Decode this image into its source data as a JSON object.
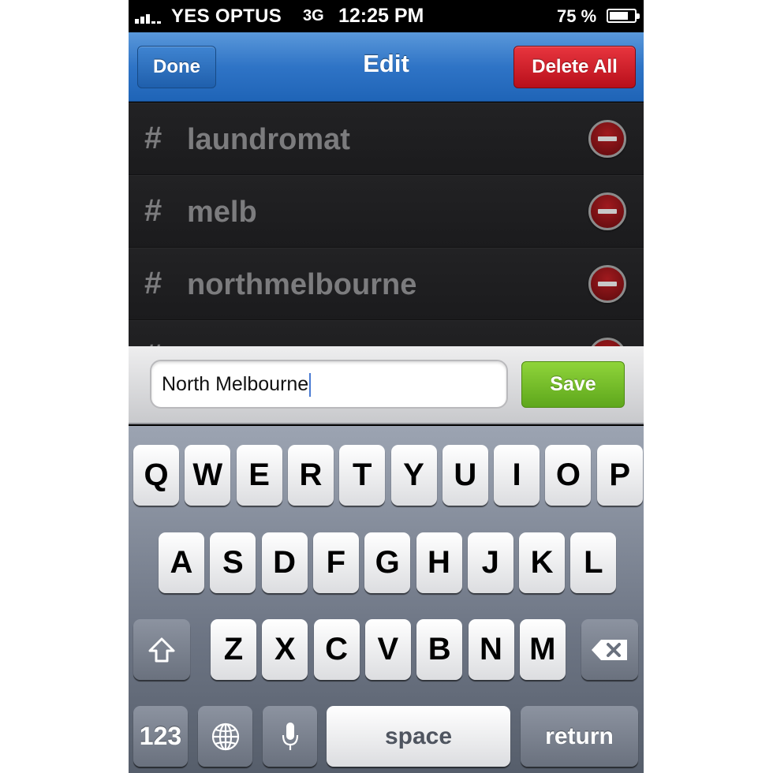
{
  "status_bar": {
    "carrier": "YES OPTUS",
    "network": "3G",
    "time": "12:25 PM",
    "battery_percent": "75 %",
    "battery_level": 0.75
  },
  "nav": {
    "title": "Edit",
    "done_label": "Done",
    "delete_all_label": "Delete All"
  },
  "tags": {
    "hash_symbol": "#",
    "items": [
      {
        "label": "laundromat"
      },
      {
        "label": "melb"
      },
      {
        "label": "northmelbourne"
      }
    ]
  },
  "input": {
    "value": "North Melbourne",
    "save_label": "Save"
  },
  "keyboard": {
    "row1": [
      "Q",
      "W",
      "E",
      "R",
      "T",
      "Y",
      "U",
      "I",
      "O",
      "P"
    ],
    "row2": [
      "A",
      "S",
      "D",
      "F",
      "G",
      "H",
      "J",
      "K",
      "L"
    ],
    "row3": [
      "Z",
      "X",
      "C",
      "V",
      "B",
      "N",
      "M"
    ],
    "numbers_label": "123",
    "space_label": "space",
    "return_label": "return"
  },
  "colors": {
    "nav_blue": "#2f74c6",
    "delete_red": "#c8141e",
    "save_green": "#6fb826"
  }
}
